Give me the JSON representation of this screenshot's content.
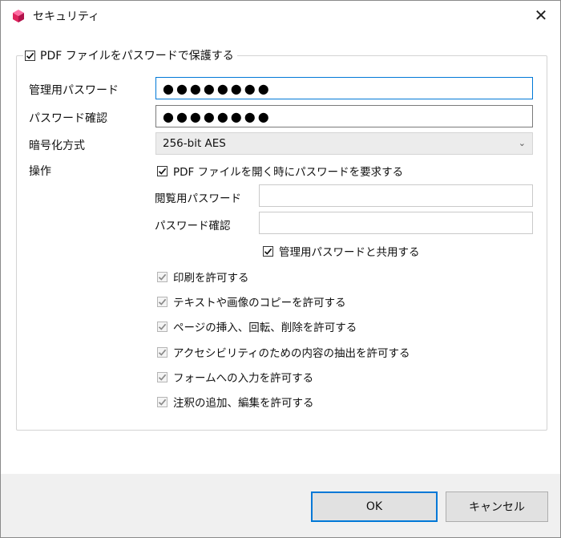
{
  "window": {
    "title": "セキュリティ",
    "close_glyph": "✕"
  },
  "protect": {
    "label": "PDF ファイルをパスワードで保護する",
    "checked": true
  },
  "fields": {
    "owner_password_label": "管理用パスワード",
    "owner_password_value": "●●●●●●●●",
    "owner_confirm_label": "パスワード確認",
    "owner_confirm_value": "●●●●●●●●",
    "encryption_label": "暗号化方式",
    "encryption_value": "256-bit AES",
    "operations_label": "操作"
  },
  "open_password": {
    "require_label": "PDF ファイルを開く時にパスワードを要求する",
    "require_checked": true,
    "view_password_label": "閲覧用パスワード",
    "view_password_value": "",
    "view_confirm_label": "パスワード確認",
    "view_confirm_value": "",
    "share_label": "管理用パスワードと共用する",
    "share_checked": true
  },
  "permissions": [
    {
      "label": "印刷を許可する",
      "checked": true,
      "enabled": false
    },
    {
      "label": "テキストや画像のコピーを許可する",
      "checked": true,
      "enabled": false
    },
    {
      "label": "ページの挿入、回転、削除を許可する",
      "checked": true,
      "enabled": false
    },
    {
      "label": "アクセシビリティのための内容の抽出を許可する",
      "checked": true,
      "enabled": false
    },
    {
      "label": "フォームへの入力を許可する",
      "checked": true,
      "enabled": false
    },
    {
      "label": "注釈の追加、編集を許可する",
      "checked": true,
      "enabled": false
    }
  ],
  "buttons": {
    "ok": "OK",
    "cancel": "キャンセル"
  },
  "colors": {
    "focus": "#0078d7",
    "footer_bg": "#f0f0f0",
    "disabled_check": "#8a8a8a"
  },
  "icons": {
    "app": "app-cube-icon",
    "close": "close-icon",
    "dropdown": "chevron-down-icon",
    "check": "checkmark-icon"
  }
}
